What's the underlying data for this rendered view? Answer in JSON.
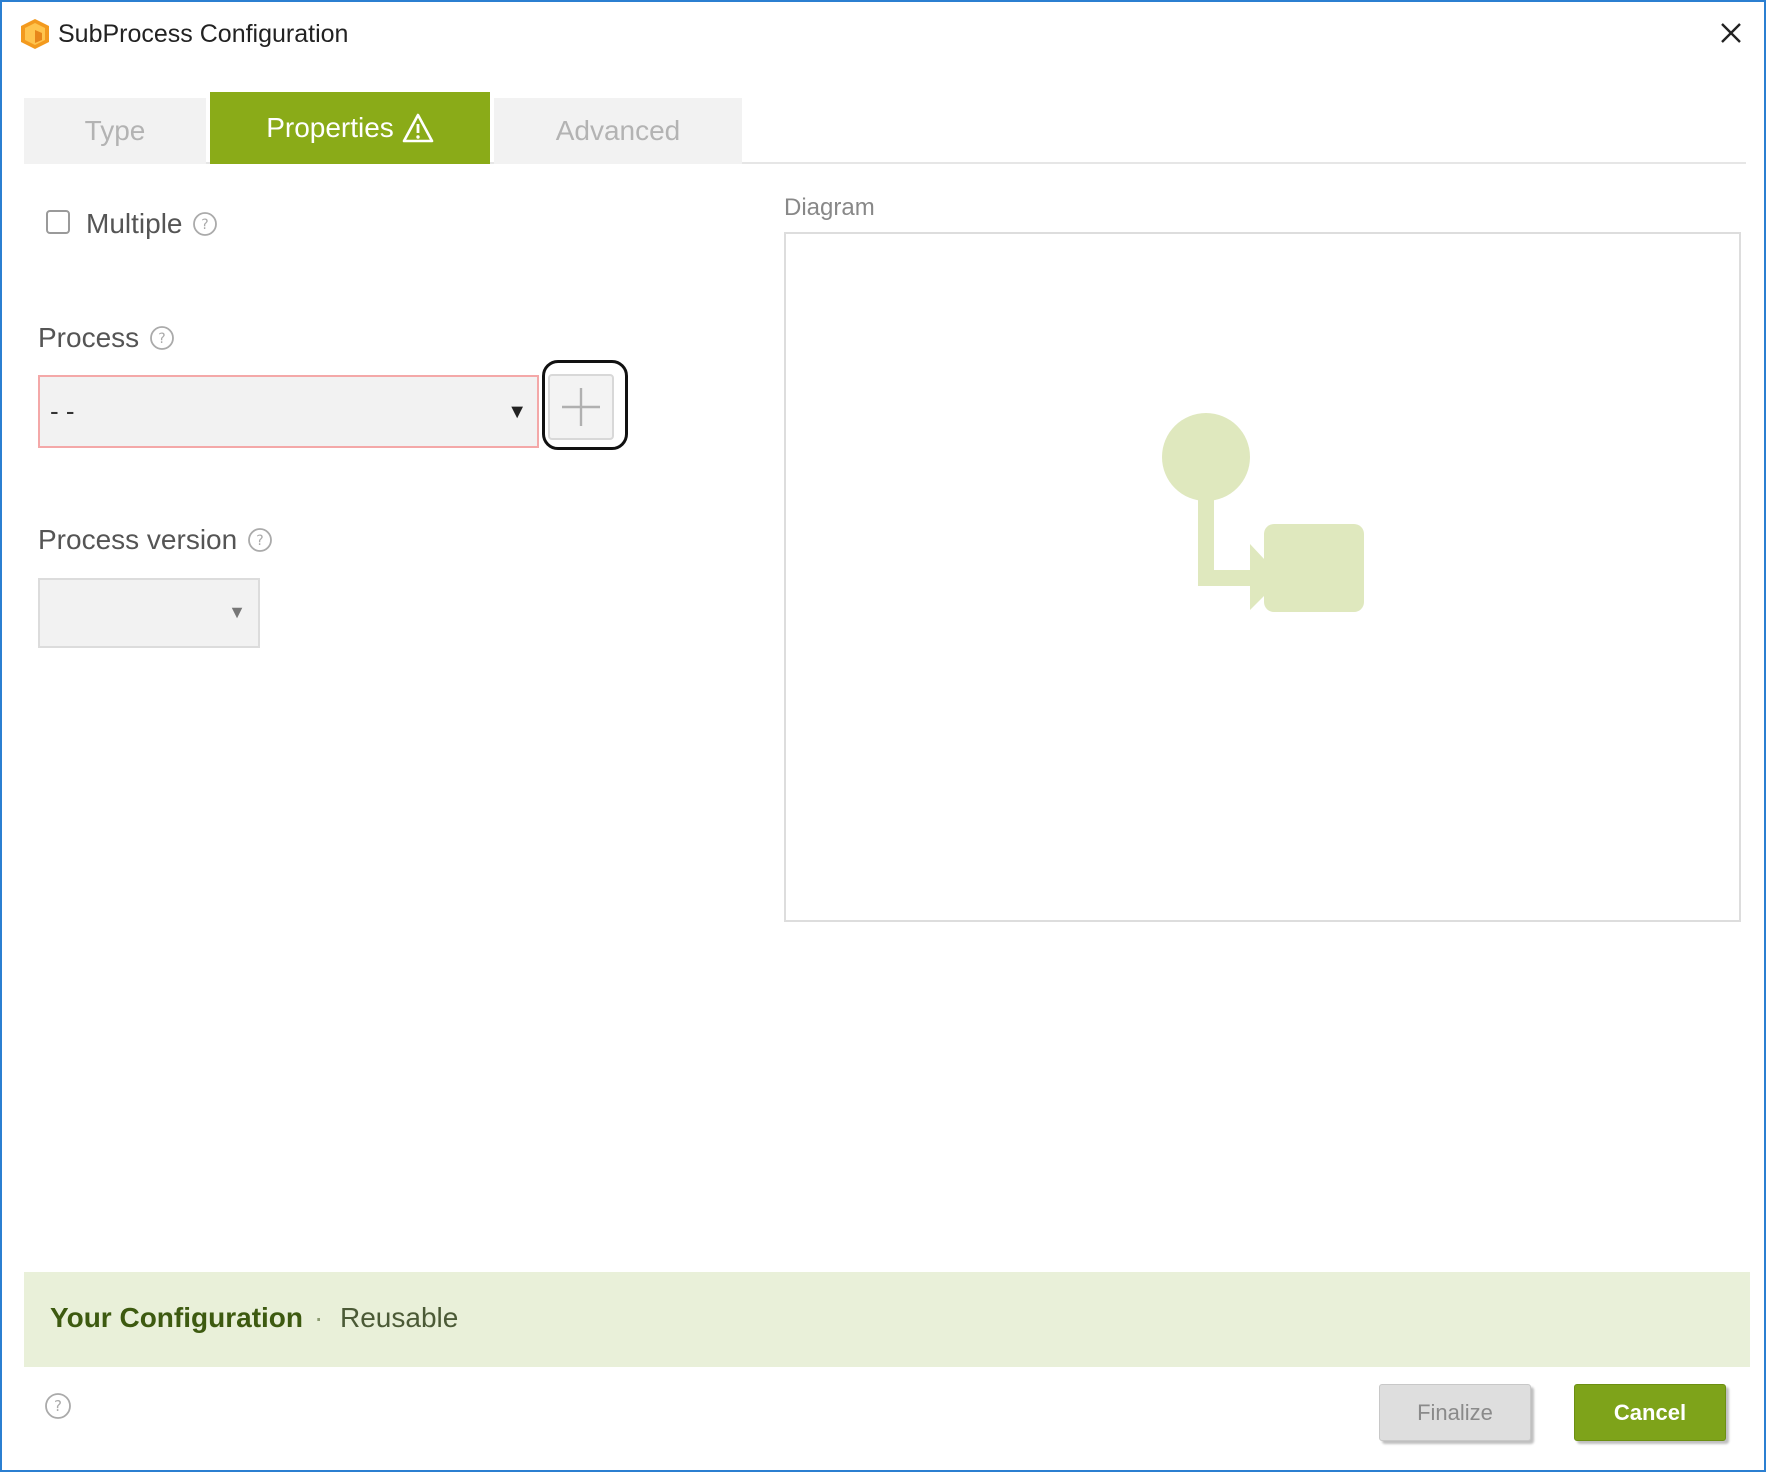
{
  "window": {
    "title": "SubProcess Configuration",
    "border_color": "#2b7fd1"
  },
  "tabs": [
    {
      "label": "Type",
      "active": false
    },
    {
      "label": "Properties",
      "active": true,
      "icon": "warning-icon"
    },
    {
      "label": "Advanced",
      "active": false
    }
  ],
  "form": {
    "multiple_label": "Multiple",
    "multiple_checked": false,
    "process_label": "Process",
    "process_value": "- -",
    "process_version_label": "Process version",
    "process_version_value": ""
  },
  "diagram": {
    "label": "Diagram",
    "art_color": "#dfe8be"
  },
  "configuration": {
    "title": "Your Configuration",
    "separator": "·",
    "value": "Reusable"
  },
  "buttons": {
    "finalize": "Finalize",
    "cancel": "Cancel"
  },
  "colors": {
    "accent": "#8aab18",
    "config_bg": "#e9f0d9",
    "error_border": "#f4a8a8"
  }
}
